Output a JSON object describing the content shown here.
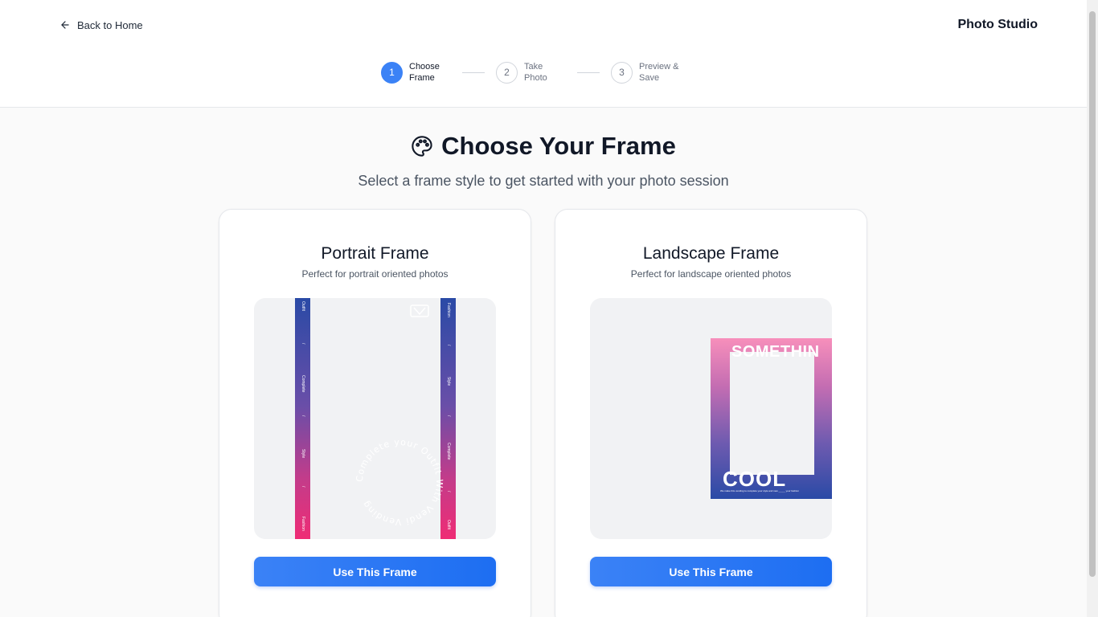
{
  "header": {
    "back_label": "Back to Home",
    "brand": "Photo Studio"
  },
  "stepper": {
    "steps": [
      {
        "number": "1",
        "label": "Choose Frame",
        "active": true
      },
      {
        "number": "2",
        "label": "Take Photo",
        "active": false
      },
      {
        "number": "3",
        "label": "Preview & Save",
        "active": false
      }
    ]
  },
  "main": {
    "title": "Choose Your Frame",
    "subtitle": "Select a frame style to get started with your photo session"
  },
  "cards": [
    {
      "title": "Portrait Frame",
      "description": "Perfect for portrait oriented photos",
      "button_label": "Use This Frame",
      "preview": {
        "left_strip_words": [
          "Outfit",
          "/",
          "Complete",
          "/",
          "Style",
          "/",
          "Fashion"
        ],
        "right_strip_words": [
          "Fashion",
          "/",
          "Style",
          "/",
          "Complete",
          "/",
          "Outfit"
        ],
        "circular_text": "Complete your Outfit With Vendi Vending"
      }
    },
    {
      "title": "Landscape Frame",
      "description": "Perfect for landscape oriented photos",
      "button_label": "Use This Frame",
      "preview": {
        "top_text": "SOMETHIN",
        "bottom_text": "COOL",
        "fine_print": "We make this vending to complete your style and new _____ your fashion"
      }
    }
  ],
  "colors": {
    "accent": "#3b82f6",
    "frame_gradient": [
      "#2a4aa6",
      "#6a4ea8",
      "#ef2c75"
    ]
  },
  "icons": {
    "back": "arrow-left-icon",
    "title": "palette-icon"
  }
}
